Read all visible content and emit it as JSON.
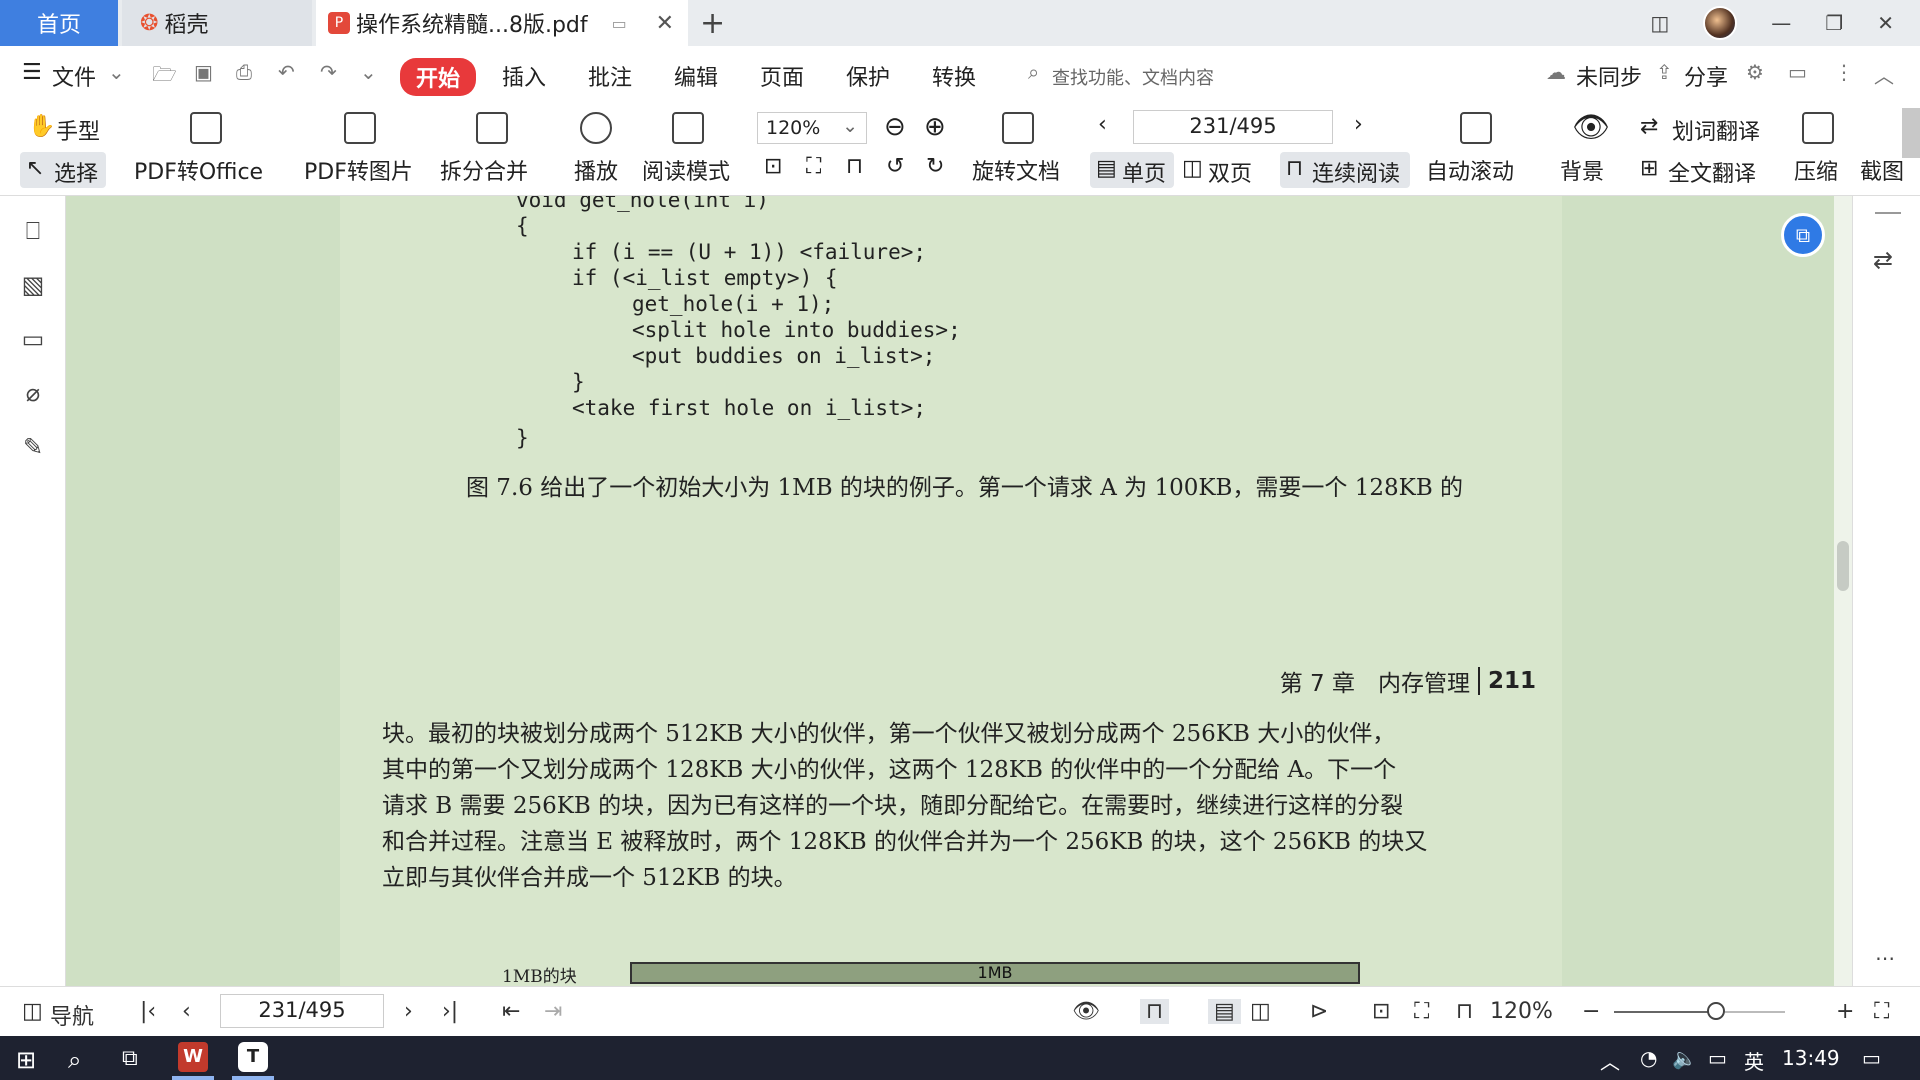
{
  "tabs": {
    "home": "首页",
    "daoke": "稻壳",
    "pdf": "操作系统精髓...8版.pdf"
  },
  "menu": {
    "file": "文件",
    "items": [
      "开始",
      "插入",
      "批注",
      "编辑",
      "页面",
      "保护",
      "转换"
    ],
    "search_placeholder": "查找功能、文档内容",
    "sync": "未同步",
    "share": "分享"
  },
  "ribbon": {
    "hand": "手型",
    "select": "选择",
    "pdf_to_office": "PDF转Office",
    "pdf_to_image": "PDF转图片",
    "split_merge": "拆分合并",
    "play": "播放",
    "read_mode": "阅读模式",
    "zoom": "120%",
    "rotate": "旋转文档",
    "page": "231/495",
    "single": "单页",
    "double": "双页",
    "continuous": "连续阅读",
    "auto_scroll": "自动滚动",
    "background": "背景",
    "word_translate": "划词翻译",
    "full_translate": "全文翻译",
    "compress": "压缩",
    "screenshot": "截图"
  },
  "document": {
    "code_lines": [
      "void get_hole(int i)",
      "{",
      "if (i == (U + 1)) <failure>;",
      "if (<i_list empty>) {",
      "get_hole(i + 1);",
      "<split hole into buddies>;",
      "<put buddies on i_list>;",
      "}",
      "<take first hole on i_list>;",
      "}"
    ],
    "page1_text": "图 7.6 给出了一个初始大小为 1MB 的块的例子。第一个请求 A 为 100KB，需要一个 128KB 的",
    "chapter_header": "第 7 章　内存管理",
    "page_number": "211",
    "paragraph": [
      "块。最初的块被划分成两个 512KB 大小的伙伴，第一个伙伴又被划分成两个 256KB 大小的伙伴，",
      "其中的第一个又划分成两个 128KB 大小的伙伴，这两个 128KB 的伙伴中的一个分配给 A。下一个",
      "请求 B 需要 256KB 的块，因为已有这样的一个块，随即分配给它。在需要时，继续进行这样的分裂",
      "和合并过程。注意当 E 被释放时，两个 128KB 的伙伴合并为一个 256KB 的块，这个 256KB 的块又",
      "立即与其伙伴合并成一个 512KB 的块。"
    ],
    "figure_label": "1MB的块",
    "figure_bar": "1MB"
  },
  "statusbar": {
    "nav": "导航",
    "page": "231/495",
    "zoom": "120%"
  },
  "taskbar": {
    "lang": "英",
    "time": "13:49"
  }
}
